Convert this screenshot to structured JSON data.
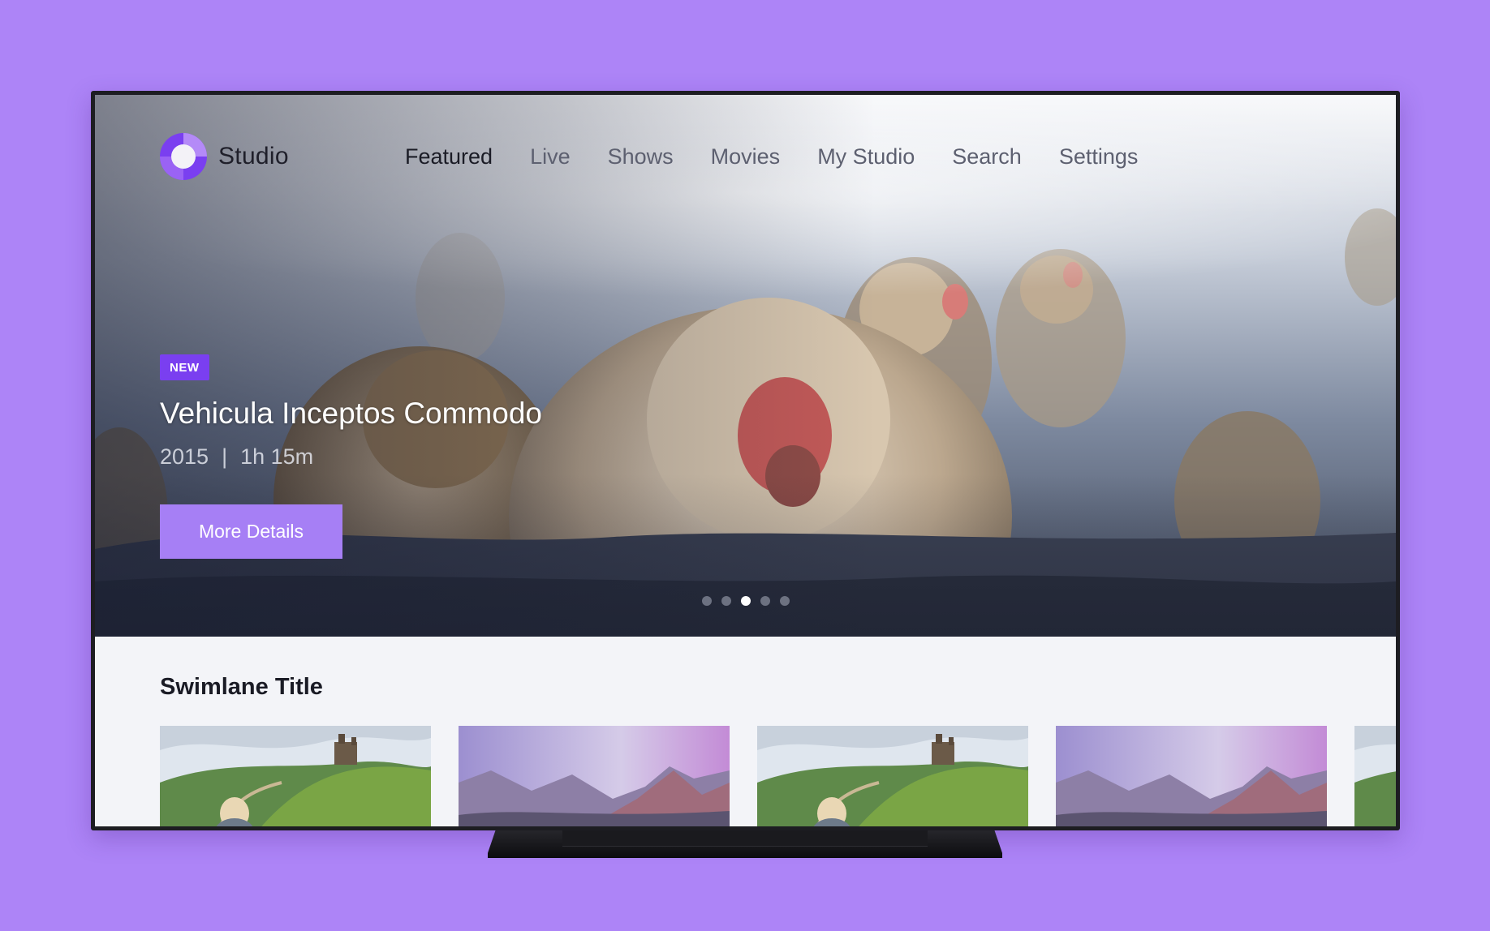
{
  "brand": {
    "name": "Studio",
    "accent": "#7a3ff0"
  },
  "nav": {
    "items": [
      {
        "label": "Featured",
        "active": true
      },
      {
        "label": "Live",
        "active": false
      },
      {
        "label": "Shows",
        "active": false
      },
      {
        "label": "Movies",
        "active": false
      },
      {
        "label": "My Studio",
        "active": false
      },
      {
        "label": "Search",
        "active": false
      },
      {
        "label": "Settings",
        "active": false
      }
    ]
  },
  "hero": {
    "badge": "NEW",
    "title": "Vehicula Inceptos Commodo",
    "year": "2015",
    "separator": "|",
    "duration": "1h 15m",
    "cta_label": "More Details",
    "carousel": {
      "count": 5,
      "active_index": 2
    }
  },
  "swimlane": {
    "title": "Swimlane Title",
    "tiles": [
      {
        "image": "green-hill-monastery"
      },
      {
        "image": "purple-mountain-range"
      },
      {
        "image": "green-hill-monastery"
      },
      {
        "image": "purple-mountain-range"
      },
      {
        "image": "green-hill-monastery"
      }
    ]
  }
}
